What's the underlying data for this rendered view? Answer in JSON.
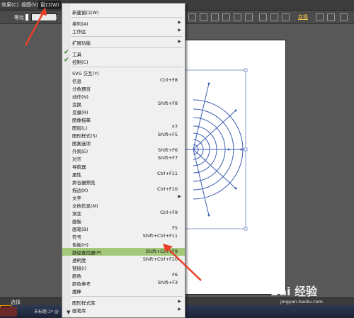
{
  "menubar": {
    "items": [
      {
        "label": "效果(C)"
      },
      {
        "label": "视图(V)"
      },
      {
        "label": "窗口(W)"
      }
    ]
  },
  "toolbar": {
    "stroke_label": "等比",
    "basic_label": "基",
    "transform_label": "变换"
  },
  "menu": {
    "items": [
      {
        "label": "新建窗口(W)",
        "shortcut": "",
        "submenu": false,
        "checked": false
      },
      {
        "label": "排列(A)",
        "shortcut": "",
        "submenu": true,
        "checked": false
      },
      {
        "label": "工作区",
        "shortcut": "",
        "submenu": true,
        "checked": false
      },
      {
        "label": "扩展功能",
        "shortcut": "",
        "submenu": true,
        "checked": false
      },
      {
        "label": "工具",
        "shortcut": "",
        "submenu": false,
        "checked": true
      },
      {
        "label": "控制(C)",
        "shortcut": "",
        "submenu": false,
        "checked": true
      },
      {
        "label": "SVG 交互(Y)",
        "shortcut": "",
        "submenu": false,
        "checked": false
      },
      {
        "label": "信息",
        "shortcut": "Ctrl+F8",
        "submenu": false,
        "checked": false
      },
      {
        "label": "分色预览",
        "shortcut": "",
        "submenu": false,
        "checked": false
      },
      {
        "label": "动作(N)",
        "shortcut": "",
        "submenu": false,
        "checked": false
      },
      {
        "label": "变换",
        "shortcut": "Shift+F8",
        "submenu": false,
        "checked": false
      },
      {
        "label": "变量(R)",
        "shortcut": "",
        "submenu": false,
        "checked": false
      },
      {
        "label": "图像描摹",
        "shortcut": "",
        "submenu": false,
        "checked": false
      },
      {
        "label": "图层(L)",
        "shortcut": "F7",
        "submenu": false,
        "checked": false
      },
      {
        "label": "图形样式(S)",
        "shortcut": "Shift+F5",
        "submenu": false,
        "checked": false
      },
      {
        "label": "图案选项",
        "shortcut": "",
        "submenu": false,
        "checked": false
      },
      {
        "label": "外观(E)",
        "shortcut": "Shift+F6",
        "submenu": false,
        "checked": false
      },
      {
        "label": "对齐",
        "shortcut": "Shift+F7",
        "submenu": false,
        "checked": false
      },
      {
        "label": "导航器",
        "shortcut": "",
        "submenu": false,
        "checked": false
      },
      {
        "label": "属性",
        "shortcut": "Ctrl+F11",
        "submenu": false,
        "checked": false
      },
      {
        "label": "拼合器预览",
        "shortcut": "",
        "submenu": false,
        "checked": false
      },
      {
        "label": "描边(K)",
        "shortcut": "Ctrl+F10",
        "submenu": false,
        "checked": false
      },
      {
        "label": "文字",
        "shortcut": "",
        "submenu": true,
        "checked": false
      },
      {
        "label": "文档信息(M)",
        "shortcut": "",
        "submenu": false,
        "checked": false
      },
      {
        "label": "渐变",
        "shortcut": "Ctrl+F9",
        "submenu": false,
        "checked": false
      },
      {
        "label": "画板",
        "shortcut": "",
        "submenu": false,
        "checked": false
      },
      {
        "label": "画笔(B)",
        "shortcut": "F5",
        "submenu": false,
        "checked": false
      },
      {
        "label": "符号",
        "shortcut": "Shift+Ctrl+F11",
        "submenu": false,
        "checked": false
      },
      {
        "label": "色板(H)",
        "shortcut": "",
        "submenu": false,
        "checked": false
      },
      {
        "label": "路径查找器(P)",
        "shortcut": "Shift+Ctrl+F9",
        "submenu": false,
        "checked": false,
        "highlighted": true
      },
      {
        "label": "透明度",
        "shortcut": "Shift+Ctrl+F10",
        "submenu": false,
        "checked": false
      },
      {
        "label": "链接(I)",
        "shortcut": "",
        "submenu": false,
        "checked": false
      },
      {
        "label": "颜色",
        "shortcut": "F6",
        "submenu": false,
        "checked": false
      },
      {
        "label": "颜色参考",
        "shortcut": "Shift+F3",
        "submenu": false,
        "checked": false
      },
      {
        "label": "魔棒",
        "shortcut": "",
        "submenu": false,
        "checked": false
      },
      {
        "label": "图形样式库",
        "shortcut": "",
        "submenu": true,
        "checked": false
      },
      {
        "label": "画笔库",
        "shortcut": "",
        "submenu": true,
        "checked": false
      }
    ]
  },
  "status": {
    "label": "选择"
  },
  "taskbar": {
    "app_label": "Ai",
    "task_label": "未标题-2* @"
  },
  "watermark": {
    "logo": "Bai 经验",
    "url": "jingyan.baidu.com"
  },
  "colors": {
    "highlight": "#a4c879",
    "artwork_stroke": "#3d5fb0",
    "arrow": "#e8402a"
  }
}
